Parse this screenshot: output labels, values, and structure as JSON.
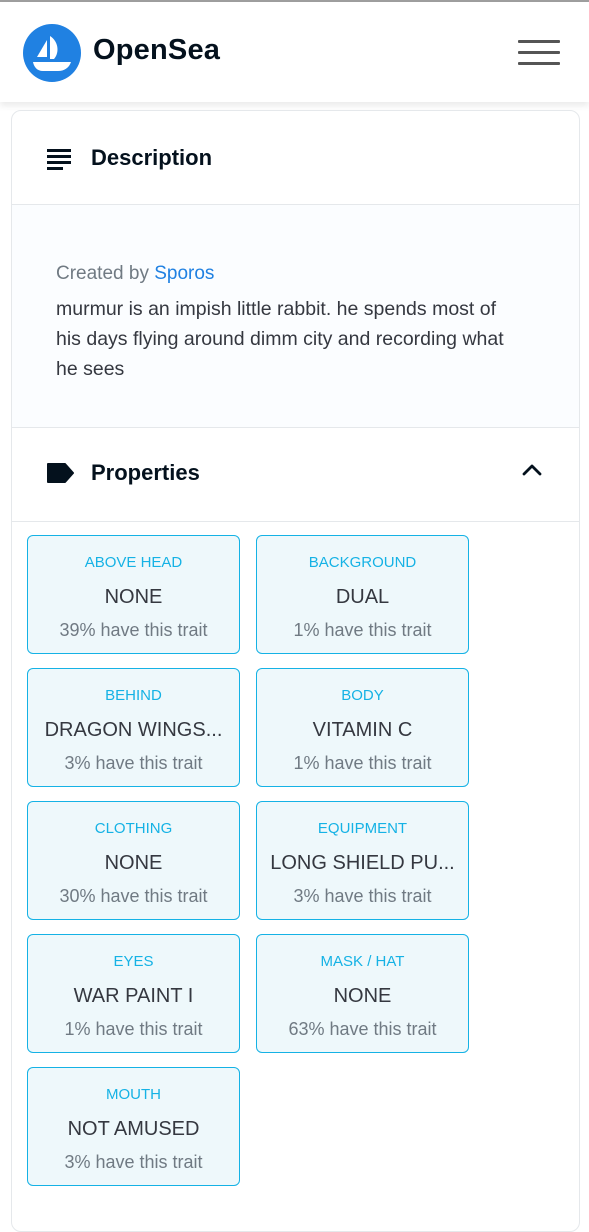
{
  "header": {
    "brand": "OpenSea",
    "logo_icon": "opensea-boat-icon",
    "menu_icon": "hamburger-menu-icon"
  },
  "description": {
    "title": "Description",
    "icon": "description-lines-icon",
    "created_by_prefix": "Created by",
    "author": "Sporos",
    "text": "murmur is an impish little rabbit. he spends most of his days flying around dimm city and recording what he sees"
  },
  "properties": {
    "title": "Properties",
    "icon": "tag-icon",
    "toggle_icon": "chevron-up-icon",
    "traits": [
      {
        "type": "ABOVE HEAD",
        "value": "NONE",
        "rarity": "39% have this trait"
      },
      {
        "type": "BACKGROUND",
        "value": "DUAL",
        "rarity": "1% have this trait"
      },
      {
        "type": "BEHIND",
        "value": "DRAGON WINGS...",
        "rarity": "3% have this trait"
      },
      {
        "type": "BODY",
        "value": "VITAMIN C",
        "rarity": "1% have this trait"
      },
      {
        "type": "CLOTHING",
        "value": "NONE",
        "rarity": "30% have this trait"
      },
      {
        "type": "EQUIPMENT",
        "value": "LONG SHIELD PU...",
        "rarity": "3% have this trait"
      },
      {
        "type": "EYES",
        "value": "WAR PAINT I",
        "rarity": "1% have this trait"
      },
      {
        "type": "MASK / HAT",
        "value": "NONE",
        "rarity": "63% have this trait"
      },
      {
        "type": "MOUTH",
        "value": "NOT AMUSED",
        "rarity": "3% have this trait"
      }
    ]
  },
  "colors": {
    "brand_blue": "#2081e2",
    "trait_accent": "#15b2e5",
    "trait_background": "#eef8fb"
  }
}
